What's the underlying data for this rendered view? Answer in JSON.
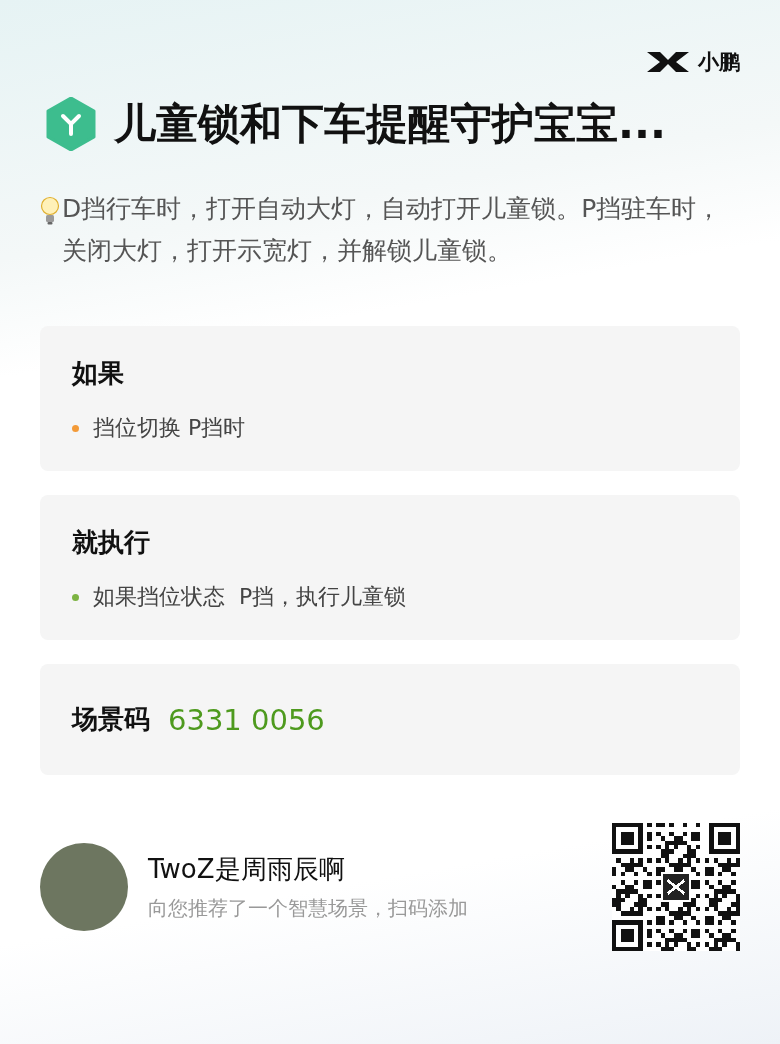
{
  "brand": {
    "name": "小鹏"
  },
  "title": "儿童锁和下车提醒守护宝宝...",
  "description": "D挡行车时，打开自动大灯，自动打开儿童锁。P挡驻车时，关闭大灯，打开示宽灯，并解锁儿童锁。",
  "sections": [
    {
      "heading": "如果",
      "items": [
        {
          "text": "挡位切换 P挡时",
          "color": "#f39a38"
        }
      ]
    },
    {
      "heading": "就执行",
      "items": [
        {
          "text": "如果挡位状态  P挡，执行儿童锁",
          "color": "#7cb342"
        }
      ]
    }
  ],
  "scene_code": {
    "label": "场景码",
    "value": "6331 0056"
  },
  "share": {
    "user": "TwoZ是周雨辰啊",
    "message": "向您推荐了一个智慧场景，扫码添加"
  }
}
